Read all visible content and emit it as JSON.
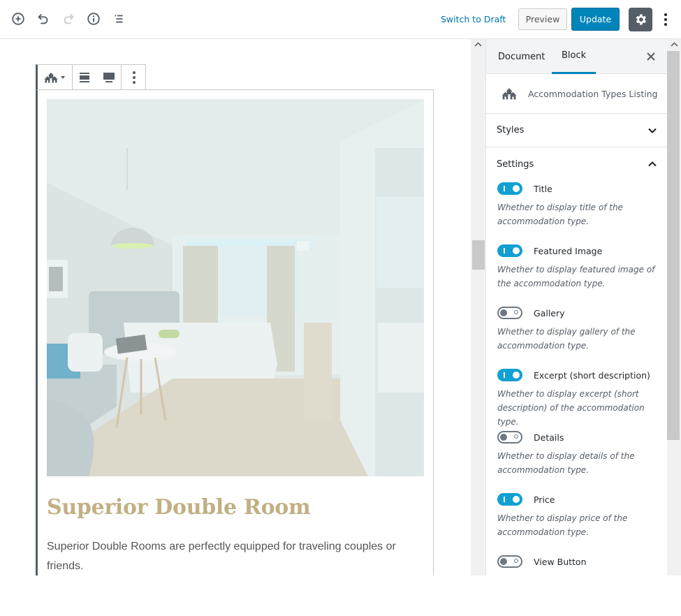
{
  "topbar": {
    "icons": [
      "add-block-icon",
      "undo-icon",
      "redo-icon",
      "info-icon",
      "block-navigation-icon"
    ],
    "switch_to_draft": "Switch to Draft",
    "preview": "Preview",
    "update": "Update",
    "settings_icon": "gear-icon",
    "more_icon": "more-vertical-icon",
    "accent": "#0085ba"
  },
  "block_toolbar": {
    "block_type_icon": "accommodation-types-icon",
    "buttons": [
      "align-wide-icon",
      "align-full-icon",
      "more-options-icon"
    ]
  },
  "block": {
    "image_alt": "Hotel room with double bed, pendant lamp, round table and curtains",
    "title": "Superior Double Room",
    "description": "Superior Double Rooms are perfectly equipped for traveling couples or friends.",
    "title_color": "#c1b083"
  },
  "sidebar": {
    "tabs": [
      {
        "label": "Document",
        "active": false
      },
      {
        "label": "Block",
        "active": true
      }
    ],
    "block_card": {
      "title": "Accommodation Types Listing"
    },
    "panels": [
      {
        "title": "Styles",
        "open": false
      },
      {
        "title": "Settings",
        "open": true
      }
    ],
    "settings": [
      {
        "label": "Title",
        "enabled": true,
        "help": "Whether to display title of the accommodation type."
      },
      {
        "label": "Featured Image",
        "enabled": true,
        "help": "Whether to display featured image of the accommodation type."
      },
      {
        "label": "Gallery",
        "enabled": false,
        "help": "Whether to display gallery of the accommodation type."
      },
      {
        "label": "Excerpt (short description)",
        "enabled": true,
        "help": "Whether to display excerpt (short description) of the accommodation type."
      },
      {
        "label": "Details",
        "enabled": false,
        "help": "Whether to display details of the accommodation type."
      },
      {
        "label": "Price",
        "enabled": true,
        "help": "Whether to display price of the accommodation type."
      },
      {
        "label": "View Button",
        "enabled": false,
        "help": ""
      }
    ],
    "toggle_on_color": "#11a0d2"
  }
}
